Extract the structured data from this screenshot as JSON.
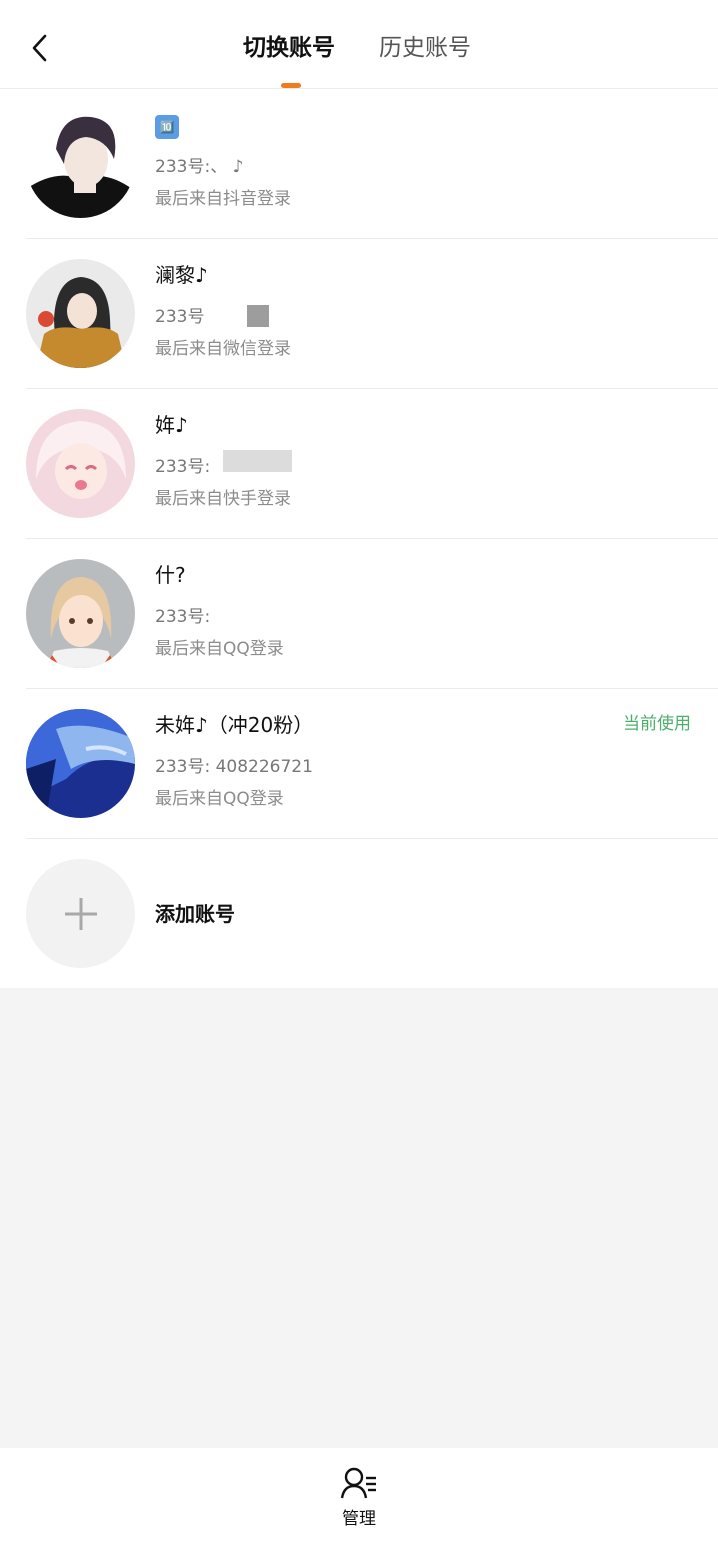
{
  "header": {
    "tabs": [
      {
        "label": "切换账号",
        "active": true
      },
      {
        "label": "历史账号",
        "active": false
      }
    ],
    "accent_color": "#f07c1f"
  },
  "accounts": [
    {
      "name": "🔟",
      "uid_label": "233号:",
      "uid_value": "、        ♪",
      "login_source": "最后来自抖音登录",
      "current": false
    },
    {
      "name": "澜黎♪",
      "uid_label": "233号",
      "uid_value": "",
      "login_source": "最后来自微信登录",
      "current": false
    },
    {
      "name": "姩♪",
      "uid_label": "233号:",
      "uid_value": "",
      "login_source": "最后来自快手登录",
      "current": false
    },
    {
      "name": "什?",
      "uid_label": "233号:",
      "uid_value": "",
      "login_source": "最后来自QQ登录",
      "current": false
    },
    {
      "name": "未姩♪（冲20粉）",
      "uid_label": "233号:",
      "uid_value": "408226721",
      "login_source": "最后来自QQ登录",
      "current": true,
      "badge": "当前使用"
    }
  ],
  "add_account": {
    "label": "添加账号"
  },
  "bottom": {
    "manage_label": "管理"
  },
  "colors": {
    "current_badge": "#4caf6a"
  }
}
